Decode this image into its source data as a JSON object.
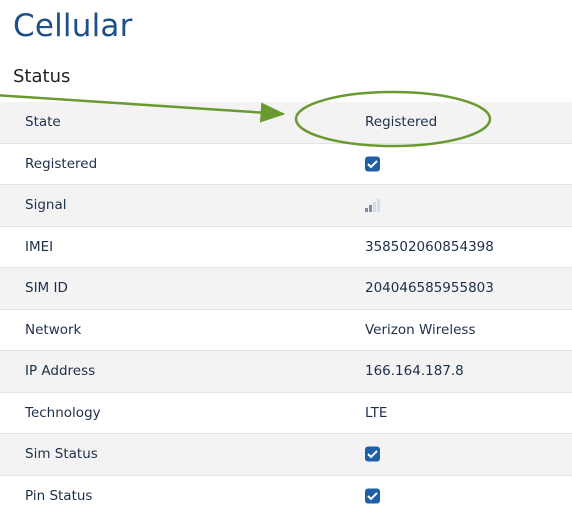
{
  "page": {
    "title": "Cellular",
    "section_title": "Status"
  },
  "status_rows": [
    {
      "label": "State",
      "value": "Registered"
    },
    {
      "label": "Registered",
      "value_type": "checkbox",
      "checked": true
    },
    {
      "label": "Signal",
      "value_type": "signal-icon"
    },
    {
      "label": "IMEI",
      "value": "358502060854398"
    },
    {
      "label": "SIM ID",
      "value": "204046585955803"
    },
    {
      "label": "Network",
      "value": "Verizon Wireless"
    },
    {
      "label": "IP Address",
      "value": "166.164.187.8"
    },
    {
      "label": "Technology",
      "value": "LTE"
    },
    {
      "label": "Sim Status",
      "value_type": "checkbox",
      "checked": true
    },
    {
      "label": "Pin Status",
      "value_type": "checkbox",
      "checked": true
    }
  ],
  "colors": {
    "title": "#1d4f8c",
    "checkbox": "#1f5fa8",
    "annotation": "#6a9a2f"
  }
}
